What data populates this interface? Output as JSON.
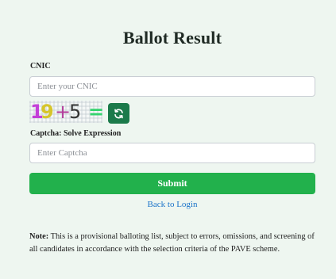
{
  "page": {
    "title": "Ballot Result"
  },
  "form": {
    "cnic_label": "CNIC",
    "cnic_placeholder": "Enter your CNIC",
    "cnic_value": "",
    "captcha": {
      "characters": [
        "1",
        "9",
        "+",
        "5",
        "="
      ],
      "refresh_icon": "refresh-icon",
      "label": "Captcha: Solve Expression",
      "placeholder": "Enter Captcha",
      "value": ""
    },
    "submit_label": "Submit"
  },
  "links": {
    "back_to_login": "Back to Login"
  },
  "note": {
    "prefix": "Note:",
    "text": " This is a provisional balloting list, subject to errors, omissions, and screening of all candidates in accordance with the selection criteria of the PAVE scheme."
  },
  "colors": {
    "background": "#eef6f0",
    "submit": "#22b14c",
    "refresh": "#1b7a4a",
    "link": "#1a73c9"
  }
}
